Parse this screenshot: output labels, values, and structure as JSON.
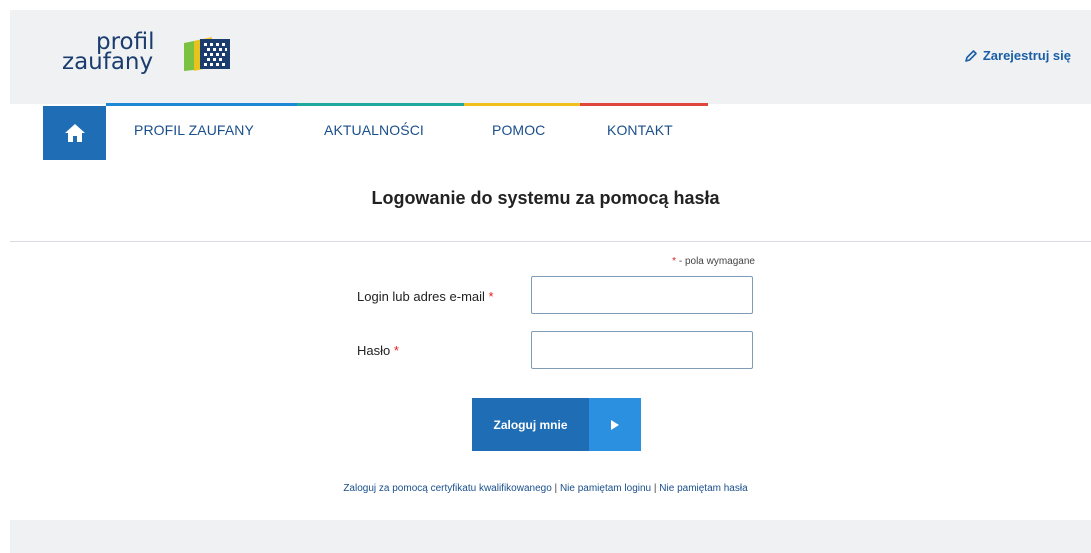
{
  "brand": {
    "logo_line1": "profil",
    "logo_line2": "zaufany",
    "colors": {
      "primary": "#1e6db5",
      "accent": "#2b90e0",
      "required": "#e11d1d"
    }
  },
  "header": {
    "register_label": "Zarejestruj się",
    "register_icon": "pencil-icon"
  },
  "nav": {
    "home_icon": "home-icon",
    "items": [
      {
        "label": "PROFIL ZAUFANY"
      },
      {
        "label": "AKTUALNOŚCI"
      },
      {
        "label": "POMOC"
      },
      {
        "label": "KONTAKT"
      }
    ],
    "bar_colors": [
      "#1e88d6",
      "#1fa8a0",
      "#f0c11e",
      "#e0463c"
    ]
  },
  "page": {
    "title": "Logowanie do systemu za pomocą hasła",
    "required_star": "*",
    "required_note": " - pola wymagane"
  },
  "form": {
    "login_label": "Login lub adres e-mail",
    "login_value": "",
    "password_label": "Hasło",
    "password_value": "",
    "submit_label": "Zaloguj mnie",
    "submit_icon": "play-arrow-icon"
  },
  "links": {
    "cert": "Zaloguj za pomocą certyfikatu kwalifikowanego",
    "separator": "|",
    "forgot_login": "Nie pamiętam loginu",
    "forgot_password": "Nie pamiętam hasła"
  }
}
